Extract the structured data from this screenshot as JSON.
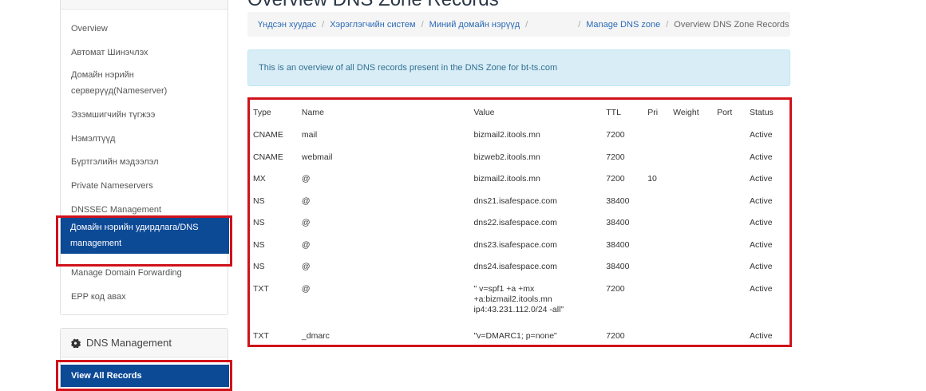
{
  "page": {
    "title": "Overview DNS Zone Records"
  },
  "breadcrumb": [
    {
      "label": "Үндсэн хуудас"
    },
    {
      "label": "Хэрэглэгчийн систем"
    },
    {
      "label": "Миний домайн нэрүүд"
    },
    {
      "label": ""
    },
    {
      "label": "Manage DNS zone"
    },
    {
      "label": "Overview DNS Zone Records"
    }
  ],
  "alert": {
    "text": "This is an overview of all DNS records present in the DNS Zone for bt-ts.com"
  },
  "sidebar": {
    "items": [
      {
        "label": "Overview"
      },
      {
        "label": "Автомат Шинэчлэх"
      },
      {
        "label": "Домайн нэрийн серверүүд(Nameserver)"
      },
      {
        "label": "Эзэмшигчийн түгжээ"
      },
      {
        "label": "Нэмэлтүүд"
      },
      {
        "label": "Бүртгэлийн мэдээлэл"
      },
      {
        "label": "Private Nameservers"
      },
      {
        "label": "DNSSEC Management"
      },
      {
        "label": "Домайн нэрийн удирдлага/DNS management"
      },
      {
        "label": "Manage Domain Forwarding"
      },
      {
        "label": "EPP код авах"
      }
    ],
    "dns_panel": {
      "title": "DNS Management",
      "icon": "gear-icon",
      "view_all_label": "View All Records"
    }
  },
  "table": {
    "headers": {
      "type": "Type",
      "name": "Name",
      "value": "Value",
      "ttl": "TTL",
      "pri": "Pri",
      "weight": "Weight",
      "port": "Port",
      "status": "Status"
    },
    "rows": [
      {
        "type": "CNAME",
        "name": "mail",
        "value": "bizmail2.itools.mn",
        "ttl": "7200",
        "pri": "",
        "weight": "",
        "port": "",
        "status": "Active"
      },
      {
        "type": "CNAME",
        "name": "webmail",
        "value": "bizweb2.itools.mn",
        "ttl": "7200",
        "pri": "",
        "weight": "",
        "port": "",
        "status": "Active"
      },
      {
        "type": "MX",
        "name": "@",
        "value": "bizmail2.itools.mn",
        "ttl": "7200",
        "pri": "10",
        "weight": "",
        "port": "",
        "status": "Active"
      },
      {
        "type": "NS",
        "name": "@",
        "value": "dns21.isafespace.com",
        "ttl": "38400",
        "pri": "",
        "weight": "",
        "port": "",
        "status": "Active"
      },
      {
        "type": "NS",
        "name": "@",
        "value": "dns22.isafespace.com",
        "ttl": "38400",
        "pri": "",
        "weight": "",
        "port": "",
        "status": "Active"
      },
      {
        "type": "NS",
        "name": "@",
        "value": "dns23.isafespace.com",
        "ttl": "38400",
        "pri": "",
        "weight": "",
        "port": "",
        "status": "Active"
      },
      {
        "type": "NS",
        "name": "@",
        "value": "dns24.isafespace.com",
        "ttl": "38400",
        "pri": "",
        "weight": "",
        "port": "",
        "status": "Active"
      },
      {
        "type": "TXT",
        "name": "@",
        "value": "\" v=spf1 +a +mx +a:bizmail2.itools.mn ip4:43.231.112.0/24 -all\"",
        "ttl": "7200",
        "pri": "",
        "weight": "",
        "port": "",
        "status": "Active"
      },
      {
        "type": "TXT",
        "name": "_dmarc",
        "value": "\"v=DMARC1; p=none\"",
        "ttl": "7200",
        "pri": "",
        "weight": "",
        "port": "",
        "status": "Active"
      }
    ]
  },
  "colors": {
    "accent_blue": "#0d4a96",
    "highlight_red": "#d0121b",
    "link_blue": "#2d6bb6",
    "alert_bg": "#d9edf7"
  }
}
